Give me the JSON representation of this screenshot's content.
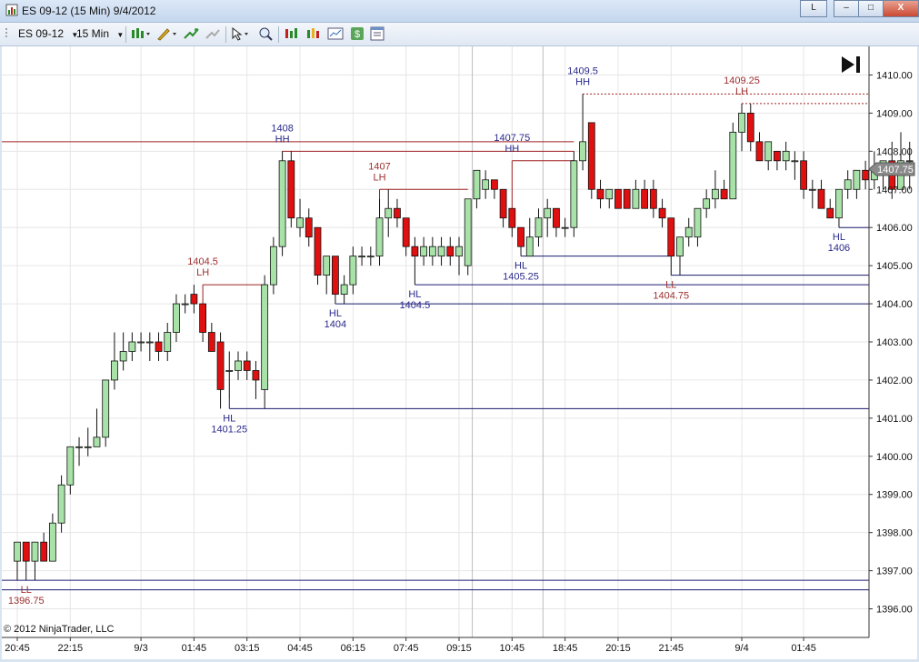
{
  "window": {
    "title": "ES 09-12 (15 Min)  9/4/2012",
    "link_btn": "L",
    "min_btn": "–",
    "max_btn": "□",
    "close_btn": "X"
  },
  "toolbar": {
    "instrument": "ES 09-12",
    "period": "15 Min"
  },
  "copyright": "© 2012 NinjaTrader, LLC",
  "last_price": "1407.75",
  "colors": {
    "up": "#a8e2a8",
    "down": "#e01010",
    "label_blue": "#2a2a8c",
    "label_red": "#a03030",
    "line_blue": "#1c1c70",
    "line_red": "#a02020"
  },
  "chart_data": {
    "type": "candlestick",
    "ylim": [
      1395.25,
      1410.75
    ],
    "y_ticks": [
      "1396.00",
      "1397.00",
      "1398.00",
      "1399.00",
      "1400.00",
      "1401.00",
      "1402.00",
      "1403.00",
      "1404.00",
      "1405.00",
      "1406.00",
      "1407.00",
      "1408.00",
      "1409.00",
      "1410.00"
    ],
    "x_ticks": [
      {
        "i": 0,
        "label": "20:45"
      },
      {
        "i": 6,
        "label": "22:15"
      },
      {
        "i": 14,
        "label": "9/3"
      },
      {
        "i": 20,
        "label": "01:45"
      },
      {
        "i": 26,
        "label": "03:15"
      },
      {
        "i": 32,
        "label": "04:45"
      },
      {
        "i": 38,
        "label": "06:15"
      },
      {
        "i": 44,
        "label": "07:45"
      },
      {
        "i": 50,
        "label": "09:15"
      },
      {
        "i": 56,
        "label": "10:45"
      },
      {
        "i": 62,
        "label": "18:45"
      },
      {
        "i": 68,
        "label": "20:15"
      },
      {
        "i": 74,
        "label": "21:45"
      },
      {
        "i": 82,
        "label": "9/4"
      },
      {
        "i": 89,
        "label": "01:45"
      }
    ],
    "session_breaks": [
      51.5,
      59.5
    ],
    "candles": [
      [
        1397.25,
        1397.75,
        1396.75,
        1397.75
      ],
      [
        1397.75,
        1397.75,
        1396.75,
        1397.25
      ],
      [
        1397.25,
        1397.75,
        1396.75,
        1397.75
      ],
      [
        1397.75,
        1398.0,
        1397.25,
        1397.25
      ],
      [
        1397.25,
        1398.5,
        1397.25,
        1398.25
      ],
      [
        1398.25,
        1399.5,
        1398.0,
        1399.25
      ],
      [
        1399.25,
        1400.25,
        1399.0,
        1400.25
      ],
      [
        1400.25,
        1400.5,
        1399.75,
        1400.25
      ],
      [
        1400.25,
        1400.75,
        1400.0,
        1400.25
      ],
      [
        1400.25,
        1401.25,
        1400.25,
        1400.5
      ],
      [
        1400.5,
        1402.0,
        1400.25,
        1402.0
      ],
      [
        1402.0,
        1403.25,
        1401.75,
        1402.5
      ],
      [
        1402.5,
        1403.25,
        1402.25,
        1402.75
      ],
      [
        1402.75,
        1403.25,
        1402.5,
        1403.0
      ],
      [
        1403.0,
        1403.25,
        1402.75,
        1403.0
      ],
      [
        1403.0,
        1403.25,
        1402.5,
        1403.0
      ],
      [
        1403.0,
        1403.25,
        1402.5,
        1402.75
      ],
      [
        1402.75,
        1403.5,
        1402.5,
        1403.25
      ],
      [
        1403.25,
        1404.25,
        1403.0,
        1404.0
      ],
      [
        1404.0,
        1404.25,
        1403.75,
        1404.0
      ],
      [
        1404.25,
        1404.5,
        1403.75,
        1404.0
      ],
      [
        1404.0,
        1404.0,
        1403.0,
        1403.25
      ],
      [
        1403.25,
        1403.5,
        1402.75,
        1402.75
      ],
      [
        1403.0,
        1403.25,
        1401.25,
        1401.75
      ],
      [
        1402.25,
        1402.75,
        1401.5,
        1402.25
      ],
      [
        1402.25,
        1402.75,
        1402.0,
        1402.5
      ],
      [
        1402.5,
        1402.75,
        1402.0,
        1402.25
      ],
      [
        1402.25,
        1402.5,
        1401.5,
        1402.0
      ],
      [
        1401.75,
        1404.75,
        1401.25,
        1404.5
      ],
      [
        1404.5,
        1405.75,
        1404.25,
        1405.5
      ],
      [
        1405.5,
        1408.0,
        1405.25,
        1407.75
      ],
      [
        1407.75,
        1408.0,
        1406.0,
        1406.25
      ],
      [
        1406.0,
        1406.75,
        1405.75,
        1406.25
      ],
      [
        1406.25,
        1406.5,
        1405.5,
        1405.75
      ],
      [
        1406.0,
        1406.0,
        1404.5,
        1404.75
      ],
      [
        1404.75,
        1405.25,
        1404.25,
        1405.25
      ],
      [
        1405.25,
        1405.25,
        1404.0,
        1404.25
      ],
      [
        1404.25,
        1404.75,
        1404.0,
        1404.5
      ],
      [
        1404.5,
        1405.5,
        1404.25,
        1405.25
      ],
      [
        1405.25,
        1405.5,
        1405.0,
        1405.25
      ],
      [
        1405.25,
        1405.5,
        1405.0,
        1405.25
      ],
      [
        1405.25,
        1406.75,
        1405.0,
        1406.25
      ],
      [
        1406.25,
        1407.0,
        1405.75,
        1406.5
      ],
      [
        1406.5,
        1406.75,
        1406.0,
        1406.25
      ],
      [
        1406.25,
        1406.25,
        1405.25,
        1405.5
      ],
      [
        1405.5,
        1405.75,
        1404.5,
        1405.25
      ],
      [
        1405.25,
        1405.75,
        1405.0,
        1405.5
      ],
      [
        1405.25,
        1405.75,
        1405.0,
        1405.5
      ],
      [
        1405.25,
        1405.75,
        1405.0,
        1405.5
      ],
      [
        1405.5,
        1405.75,
        1405.0,
        1405.25
      ],
      [
        1405.25,
        1405.75,
        1404.75,
        1405.5
      ],
      [
        1405.0,
        1406.75,
        1404.75,
        1406.75
      ],
      [
        1406.75,
        1407.5,
        1406.5,
        1407.5
      ],
      [
        1407.0,
        1407.5,
        1406.75,
        1407.25
      ],
      [
        1407.25,
        1407.25,
        1406.75,
        1407.0
      ],
      [
        1407.0,
        1407.0,
        1406.0,
        1406.25
      ],
      [
        1406.5,
        1406.5,
        1405.75,
        1406.0
      ],
      [
        1406.0,
        1406.0,
        1405.25,
        1405.5
      ],
      [
        1405.25,
        1406.25,
        1405.25,
        1405.75
      ],
      [
        1405.75,
        1406.5,
        1405.5,
        1406.25
      ],
      [
        1406.25,
        1406.75,
        1405.75,
        1406.5
      ],
      [
        1406.5,
        1406.5,
        1405.75,
        1406.0
      ],
      [
        1406.0,
        1406.25,
        1405.75,
        1406.0
      ],
      [
        1406.0,
        1408.0,
        1405.75,
        1407.75
      ],
      [
        1407.75,
        1409.5,
        1407.5,
        1408.25
      ],
      [
        1408.75,
        1408.75,
        1406.75,
        1407.0
      ],
      [
        1407.0,
        1407.25,
        1406.5,
        1406.75
      ],
      [
        1406.75,
        1407.0,
        1406.5,
        1407.0
      ],
      [
        1407.0,
        1407.0,
        1406.5,
        1406.5
      ],
      [
        1407.0,
        1407.0,
        1406.5,
        1406.5
      ],
      [
        1406.5,
        1407.25,
        1406.5,
        1407.0
      ],
      [
        1407.0,
        1407.25,
        1406.5,
        1406.5
      ],
      [
        1407.0,
        1407.25,
        1406.25,
        1406.5
      ],
      [
        1406.5,
        1406.75,
        1406.0,
        1406.25
      ],
      [
        1406.25,
        1406.25,
        1404.75,
        1405.25
      ],
      [
        1405.25,
        1405.75,
        1404.75,
        1405.75
      ],
      [
        1405.75,
        1406.25,
        1405.5,
        1406.0
      ],
      [
        1405.75,
        1406.5,
        1405.5,
        1406.5
      ],
      [
        1406.5,
        1407.0,
        1406.25,
        1406.75
      ],
      [
        1406.75,
        1407.5,
        1406.5,
        1407.0
      ],
      [
        1407.0,
        1407.25,
        1406.75,
        1406.75
      ],
      [
        1406.75,
        1408.75,
        1406.75,
        1408.5
      ],
      [
        1408.5,
        1409.25,
        1408.0,
        1409.0
      ],
      [
        1409.0,
        1409.25,
        1408.0,
        1408.25
      ],
      [
        1408.25,
        1408.5,
        1407.75,
        1407.75
      ],
      [
        1407.75,
        1408.25,
        1407.5,
        1408.25
      ],
      [
        1408.0,
        1408.0,
        1407.5,
        1407.75
      ],
      [
        1407.75,
        1408.25,
        1407.5,
        1408.0
      ],
      [
        1407.75,
        1408.0,
        1407.25,
        1407.75
      ],
      [
        1407.75,
        1408.0,
        1406.75,
        1407.0
      ],
      [
        1407.0,
        1407.25,
        1406.5,
        1407.0
      ],
      [
        1407.0,
        1407.25,
        1406.5,
        1406.5
      ],
      [
        1406.5,
        1406.75,
        1406.25,
        1406.25
      ],
      [
        1406.25,
        1407.0,
        1406.0,
        1407.0
      ],
      [
        1407.0,
        1407.5,
        1406.75,
        1407.25
      ],
      [
        1407.0,
        1407.5,
        1406.75,
        1407.5
      ],
      [
        1407.5,
        1407.75,
        1407.0,
        1407.25
      ],
      [
        1407.25,
        1408.0,
        1407.0,
        1407.5
      ],
      [
        1407.5,
        1407.75,
        1407.0,
        1407.75
      ],
      [
        1407.75,
        1408.25,
        1406.75,
        1407.0
      ],
      [
        1407.0,
        1408.5,
        1407.0,
        1407.75
      ],
      [
        1407.75,
        1408.25,
        1407.0,
        1407.75
      ]
    ],
    "swing_labels": [
      {
        "i": 1,
        "price": 1396.75,
        "pos": "below",
        "tag": "LL",
        "value": "1396.75",
        "color": "red"
      },
      {
        "i": 21,
        "price": 1404.5,
        "pos": "above",
        "tag": "LH",
        "value": "1404.5",
        "color": "red"
      },
      {
        "i": 24,
        "price": 1401.25,
        "pos": "below",
        "tag": "HL",
        "value": "1401.25",
        "color": "blue"
      },
      {
        "i": 30,
        "price": 1408.0,
        "pos": "above",
        "tag": "HH",
        "value": "1408",
        "color": "blue"
      },
      {
        "i": 36,
        "price": 1404.0,
        "pos": "below",
        "tag": "HL",
        "value": "1404",
        "color": "blue"
      },
      {
        "i": 41,
        "price": 1407.0,
        "pos": "above",
        "tag": "LH",
        "value": "1407",
        "color": "red"
      },
      {
        "i": 45,
        "price": 1404.5,
        "pos": "below",
        "tag": "HL",
        "value": "1404.5",
        "color": "blue"
      },
      {
        "i": 56,
        "price": 1407.75,
        "pos": "above",
        "tag": "HH",
        "value": "1407.75",
        "color": "blue"
      },
      {
        "i": 57,
        "price": 1405.25,
        "pos": "below",
        "tag": "HL",
        "value": "1405.25",
        "color": "blue"
      },
      {
        "i": 64,
        "price": 1409.5,
        "pos": "above",
        "tag": "HH",
        "value": "1409.5",
        "color": "blue"
      },
      {
        "i": 74,
        "price": 1404.75,
        "pos": "below",
        "tag": "LL",
        "value": "1404.75",
        "color": "red"
      },
      {
        "i": 82,
        "price": 1409.25,
        "pos": "above",
        "tag": "LH",
        "value": "1409.25",
        "color": "red"
      },
      {
        "i": 93,
        "price": 1406.0,
        "pos": "below",
        "tag": "HL",
        "value": "1406",
        "color": "blue"
      }
    ],
    "levels": [
      {
        "price": 1396.5,
        "from": -2,
        "to": "end",
        "color": "blue",
        "dash": false
      },
      {
        "price": 1396.75,
        "from": -2,
        "to": "end",
        "color": "blue",
        "dash": false
      },
      {
        "price": 1401.25,
        "from": 24,
        "to": "end",
        "color": "blue",
        "dash": false
      },
      {
        "price": 1404.0,
        "from": 36,
        "to": "end",
        "color": "blue",
        "dash": false
      },
      {
        "price": 1404.5,
        "from": 45,
        "to": "end",
        "color": "blue",
        "dash": false
      },
      {
        "price": 1404.75,
        "from": 74,
        "to": "end",
        "color": "blue",
        "dash": false
      },
      {
        "price": 1405.25,
        "from": 57,
        "to": 74,
        "color": "blue",
        "dash": false
      },
      {
        "price": 1406.0,
        "from": 93,
        "to": "end",
        "color": "blue",
        "dash": false
      },
      {
        "price": 1404.5,
        "from": 21,
        "to": 28,
        "color": "red",
        "dash": false
      },
      {
        "price": 1407.0,
        "from": 41,
        "to": 51,
        "color": "red",
        "dash": false
      },
      {
        "price": 1407.75,
        "from": 56,
        "to": 63,
        "color": "red",
        "dash": false
      },
      {
        "price": 1408.0,
        "from": 30,
        "to": 63,
        "color": "red",
        "dash": false
      },
      {
        "price": 1408.25,
        "from": -2,
        "to": 63,
        "color": "red",
        "dash": false
      },
      {
        "price": 1409.5,
        "from": 64,
        "to": "end",
        "color": "red",
        "dash": true
      },
      {
        "price": 1409.25,
        "from": 82,
        "to": "end",
        "color": "red",
        "dash": true
      }
    ]
  }
}
